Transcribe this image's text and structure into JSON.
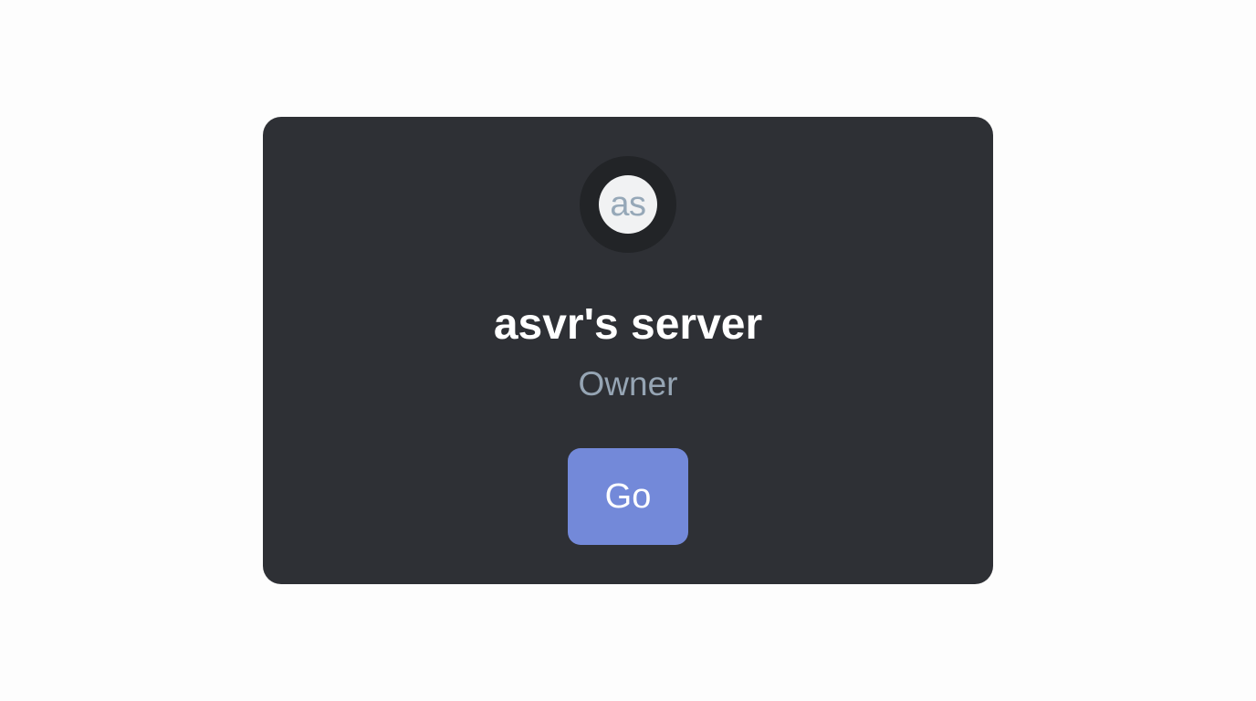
{
  "server_card": {
    "avatar_initials": "as",
    "server_name": "asvr's server",
    "role": "Owner",
    "go_label": "Go"
  },
  "colors": {
    "page_background": "#fdfdfd",
    "card_background": "#2e3035",
    "avatar_ring": "#222427",
    "avatar_fill": "#f1f2f3",
    "avatar_text": "#96a8b8",
    "role_text": "#96a5b4",
    "button_background": "#7389d9",
    "button_text": "#ffffff"
  }
}
